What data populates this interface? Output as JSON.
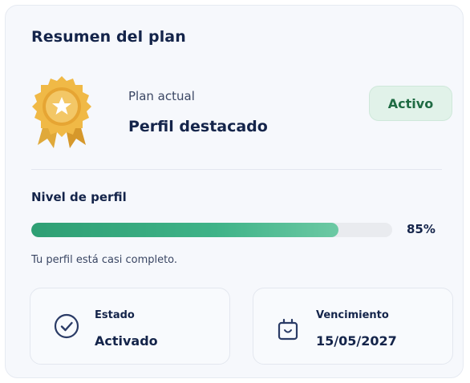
{
  "card": {
    "title": "Resumen del plan"
  },
  "plan": {
    "caption": "Plan actual",
    "name": "Perfil destacado",
    "badge": "Activo",
    "badge_color": "#1f6b43",
    "badge_bg": "#e1f2e9",
    "icon": "medal-star-icon"
  },
  "profile_level": {
    "label": "Nivel de perfil",
    "value": 85,
    "value_text": "85%",
    "hint": "Tu perfil está casi completo.",
    "accent_color": "#3fb388"
  },
  "info": [
    {
      "icon": "check-circle-icon",
      "label": "Estado",
      "value": "Activado"
    },
    {
      "icon": "calendar-bag-icon",
      "label": "Vencimiento",
      "value": "15/05/2027"
    }
  ]
}
